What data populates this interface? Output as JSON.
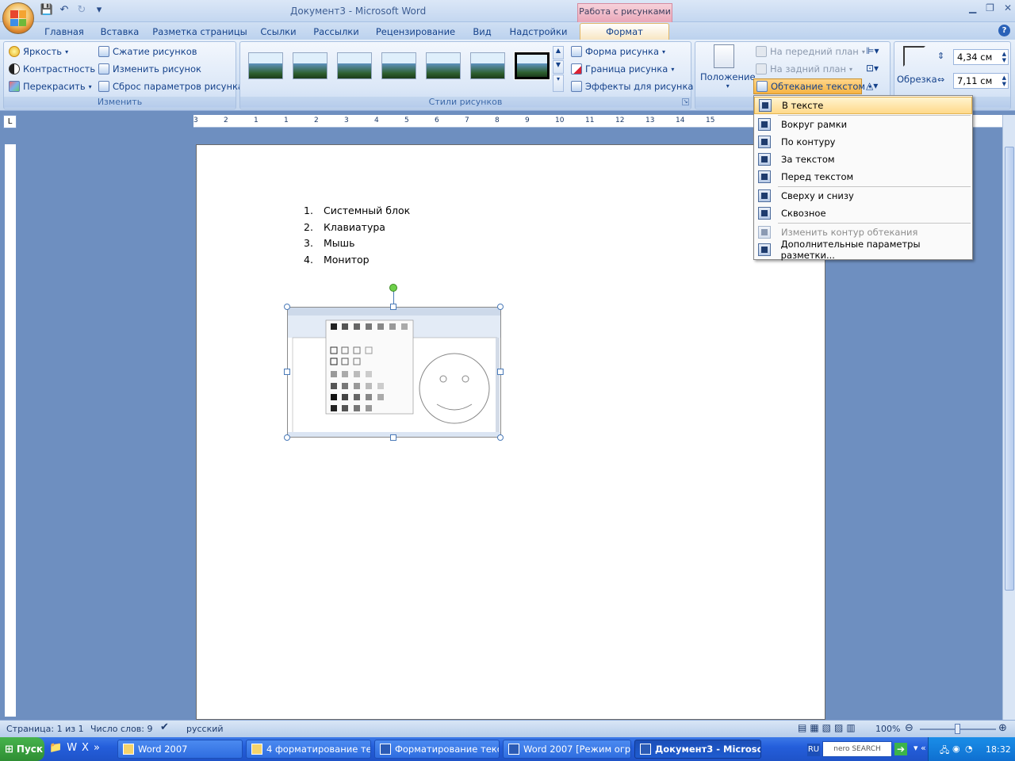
{
  "window": {
    "title": "Документ3 - Microsoft Word",
    "tools_tab": "Работа с рисунками"
  },
  "qat": {
    "save": "💾",
    "undo": "↶",
    "redo": "↻",
    "more": "▾"
  },
  "tabs": [
    {
      "label": "Главная"
    },
    {
      "label": "Вставка"
    },
    {
      "label": "Разметка страницы"
    },
    {
      "label": "Ссылки"
    },
    {
      "label": "Рассылки"
    },
    {
      "label": "Рецензирование"
    },
    {
      "label": "Вид"
    },
    {
      "label": "Надстройки"
    },
    {
      "label": "Формат"
    }
  ],
  "ribbon": {
    "adjust": {
      "label": "Изменить",
      "brightness": "Яркость",
      "contrast": "Контрастность",
      "recolor": "Перекрасить",
      "compress": "Сжатие рисунков",
      "change": "Изменить рисунок",
      "reset": "Сброс параметров рисунка"
    },
    "styles": {
      "label": "Стили рисунков",
      "shape": "Форма рисунка",
      "border": "Граница рисунка",
      "effects": "Эффекты для рисунка"
    },
    "arrange": {
      "position": "Положение",
      "front": "На передний план",
      "back": "На задний план",
      "wrap": "Обтекание текстом"
    },
    "size": {
      "crop": "Обрезка",
      "height": "4,34 см",
      "width": "7,11 см"
    }
  },
  "wrap_menu": {
    "items": [
      {
        "label": "В тексте"
      },
      {
        "label": "Вокруг рамки"
      },
      {
        "label": "По контуру"
      },
      {
        "label": "За текстом"
      },
      {
        "label": "Перед текстом"
      },
      {
        "label": "Сверху и снизу"
      },
      {
        "label": "Сквозное"
      },
      {
        "label": "Изменить контур обтекания"
      },
      {
        "label": "Дополнительные параметры разметки..."
      }
    ]
  },
  "document": {
    "list": [
      {
        "num": "1.",
        "text": "Системный блок"
      },
      {
        "num": "2.",
        "text": "Клавиатура"
      },
      {
        "num": "3.",
        "text": "Мышь"
      },
      {
        "num": "4.",
        "text": "Монитор"
      }
    ]
  },
  "ruler": {
    "tab_glyph": "L",
    "top_labels": [
      "3",
      "2",
      "1",
      "1",
      "2",
      "3",
      "4",
      "5",
      "6",
      "7",
      "8",
      "9",
      "10",
      "11",
      "12",
      "13",
      "14",
      "15"
    ]
  },
  "status": {
    "page": "Страница: 1 из 1",
    "words": "Число слов: 9",
    "lang": "русский",
    "zoom": "100%"
  },
  "taskbar": {
    "start": "Пуск",
    "buttons": [
      {
        "label": "Word 2007"
      },
      {
        "label": "4 форматирование тек..."
      },
      {
        "label": "Форматирование текст..."
      },
      {
        "label": "Word 2007 [Режим огра..."
      },
      {
        "label": "Документ3 - Microso..."
      }
    ],
    "lang": "RU",
    "search": "nero SEARCH",
    "time": "18:32"
  },
  "colors": {
    "accent": "#15428b",
    "ribbon": "#cfdff3",
    "active_tab": "#f8e6c2",
    "taskbar": "#245edb"
  }
}
